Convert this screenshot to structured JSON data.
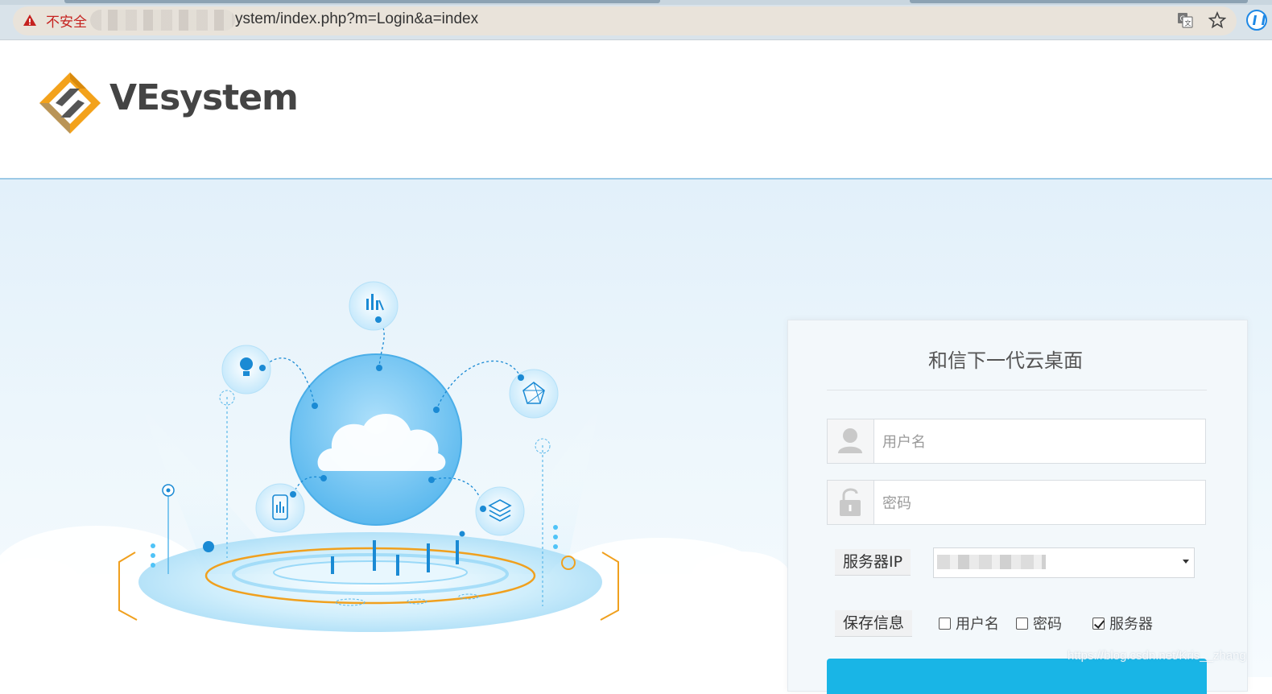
{
  "browser": {
    "security_label": "不安全",
    "url_visible": "ystem/index.php?m=Login&a=index"
  },
  "header": {
    "logo_text": "VEsystem"
  },
  "login": {
    "title": "和信下一代云桌面",
    "username_placeholder": "用户名",
    "password_placeholder": "密码",
    "server_label": "服务器IP",
    "save_label": "保存信息",
    "save_options": [
      {
        "label": "用户名",
        "checked": false
      },
      {
        "label": "密码",
        "checked": false
      },
      {
        "label": "服务器",
        "checked": true
      }
    ],
    "button_color": "#19b5e6"
  },
  "watermark": "https://blog.csdn.net/Kris__zhang",
  "icons": [
    "warning-icon",
    "translate-icon",
    "star-icon",
    "extension-icon",
    "user-icon",
    "lock-icon",
    "cloud-icon",
    "bulb-icon",
    "chart-icon",
    "network-icon",
    "layers-icon",
    "phone-chart-icon"
  ]
}
